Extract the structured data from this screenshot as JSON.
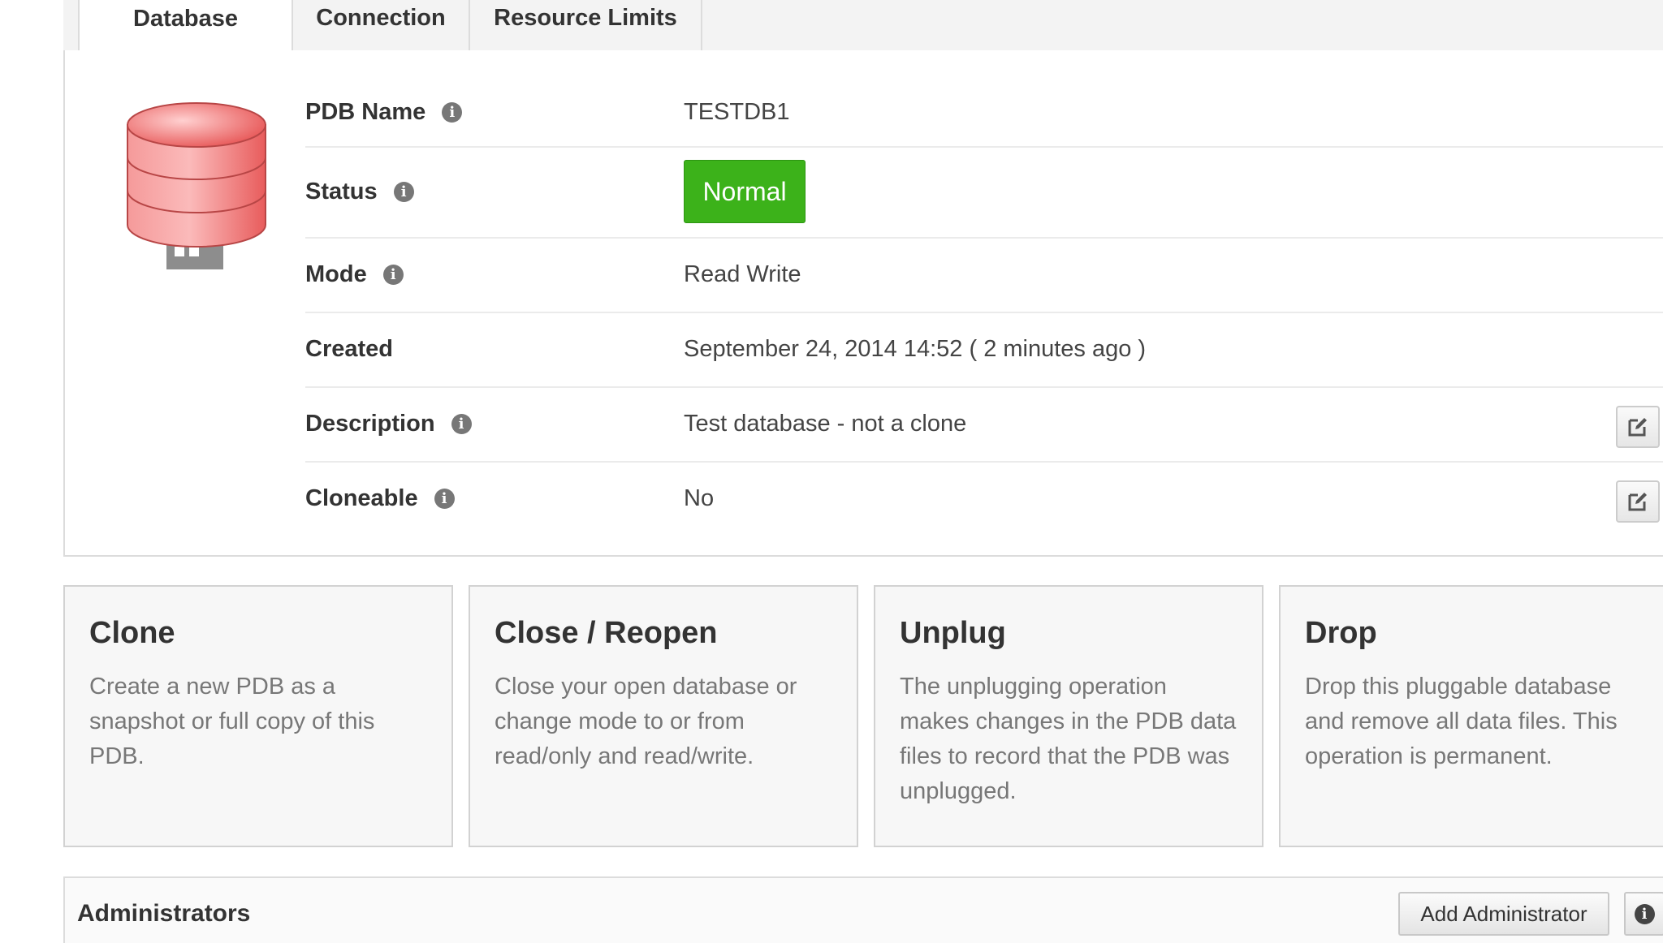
{
  "tabs": [
    {
      "label": "Database",
      "active": true
    },
    {
      "label": "Connection",
      "active": false
    },
    {
      "label": "Resource Limits",
      "active": false
    }
  ],
  "details": {
    "pdb_name_label": "PDB Name",
    "pdb_name_value": "TESTDB1",
    "status_label": "Status",
    "status_value": "Normal",
    "mode_label": "Mode",
    "mode_value": "Read Write",
    "created_label": "Created",
    "created_value": "September 24, 2014 14:52 ( 2 minutes ago )",
    "description_label": "Description",
    "description_value": "Test database - not a clone",
    "cloneable_label": "Cloneable",
    "cloneable_value": "No"
  },
  "actions": [
    {
      "title": "Clone",
      "text": "Create a new PDB as a snapshot or full copy of this PDB."
    },
    {
      "title": "Close / Reopen",
      "text": "Close your open database or change mode to or from read/only and read/write."
    },
    {
      "title": "Unplug",
      "text": "The unplugging operation makes changes in the PDB data files to record that the PDB was unplugged."
    },
    {
      "title": "Drop",
      "text": "Drop this pluggable database and remove all data files. This operation is permanent."
    }
  ],
  "administrators": {
    "title": "Administrators",
    "add_button": "Add Administrator"
  },
  "colors": {
    "status_green": "#3cb21a",
    "db_icon_red": "#f07070",
    "info_icon": "#777777"
  },
  "icons": {
    "database": "database-icon",
    "info": "info-icon",
    "edit": "edit-icon"
  }
}
